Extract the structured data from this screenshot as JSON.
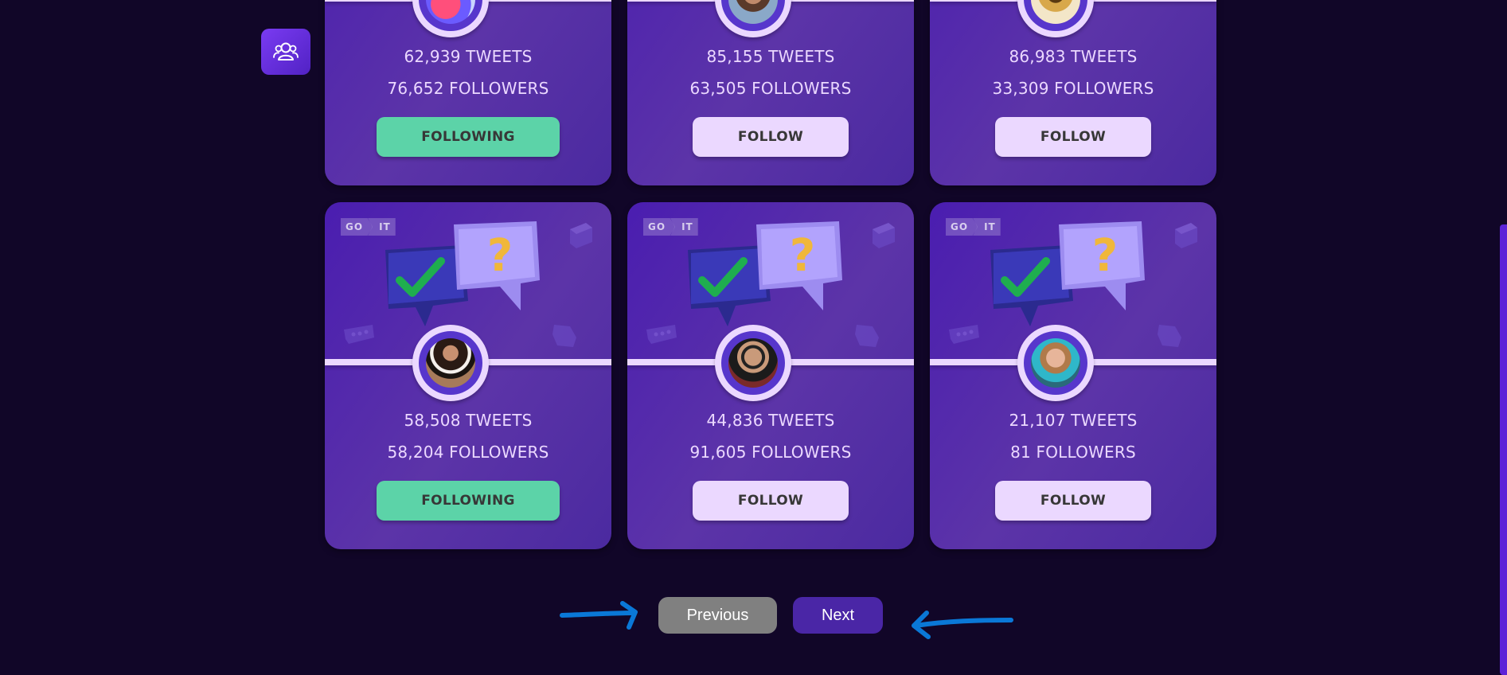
{
  "sidebar": {
    "users_icon": "users-icon"
  },
  "cards": [
    {
      "tweets": "62,939 TWEETS",
      "followers": "76,652 FOLLOWERS",
      "button": "FOLLOWING",
      "state": "following",
      "avatar": "stylized-bird-logo"
    },
    {
      "tweets": "85,155 TWEETS",
      "followers": "63,505 FOLLOWERS",
      "button": "FOLLOW",
      "state": "follow",
      "avatar": "man-photo"
    },
    {
      "tweets": "86,983 TWEETS",
      "followers": "33,309 FOLLOWERS",
      "button": "FOLLOW",
      "state": "follow",
      "avatar": "insect-photo"
    },
    {
      "tweets": "58,508 TWEETS",
      "followers": "58,204 FOLLOWERS",
      "button": "FOLLOWING",
      "state": "following",
      "avatar": "person-photo"
    },
    {
      "tweets": "44,836 TWEETS",
      "followers": "91,605 FOLLOWERS",
      "button": "FOLLOW",
      "state": "follow",
      "avatar": "man-glasses-photo"
    },
    {
      "tweets": "21,107 TWEETS",
      "followers": "81 FOLLOWERS",
      "button": "FOLLOW",
      "state": "follow",
      "avatar": "woman-photo"
    }
  ],
  "logo": {
    "part1": "GO",
    "part2": "IT"
  },
  "pagination": {
    "previous_label": "Previous",
    "next_label": "Next"
  },
  "colors": {
    "background": "#110628",
    "card": "#5736a3",
    "following": "#5cd3a8",
    "follow": "#ebd8ff",
    "previous": "#808080",
    "next": "#4a26a6",
    "arrows": "#0a78d7"
  }
}
